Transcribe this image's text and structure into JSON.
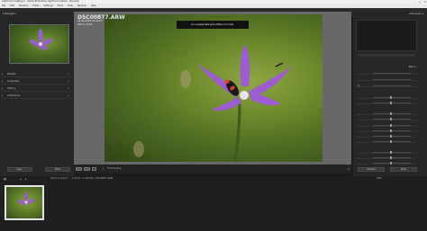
{
  "window": {
    "title": "Lightroom Catalog-2 - Adobe Photoshop Lightroom Classic - Develop",
    "controls": [
      "–",
      "□",
      "✕"
    ]
  },
  "menu": {
    "items": [
      "File",
      "Edit",
      "Develop",
      "Photo",
      "Settings",
      "Tools",
      "View",
      "Window",
      "Help"
    ]
  },
  "left_panel": {
    "navigator_label": "Navigator",
    "sections": [
      "Presets",
      "Snapshots",
      "History",
      "Collections"
    ],
    "copy_label": "Copy...",
    "paste_label": "Paste"
  },
  "photo": {
    "filename": "DSC00877.ARW",
    "datetime": "28-04-2020 15:24:05",
    "dimensions": "6504 x 4336"
  },
  "toast": {
    "message": "An unexpected end-of-file occurred."
  },
  "toolbar": {
    "soft_proofing_label": "Soft Proofing"
  },
  "right_panel": {
    "histogram_label": "Histogram",
    "basic_label": "Basic",
    "previous_label": "Previous",
    "reset_label": "Reset"
  },
  "filmstrip": {
    "source_text": "Previous Import",
    "path_text": "1 photo / 1 selected / DSC00877.ARW",
    "filter_label": "Filter :"
  },
  "colors": {
    "flower": "#9a5ad0",
    "toast_bg": "#111111",
    "panel_bg": "#262626"
  }
}
